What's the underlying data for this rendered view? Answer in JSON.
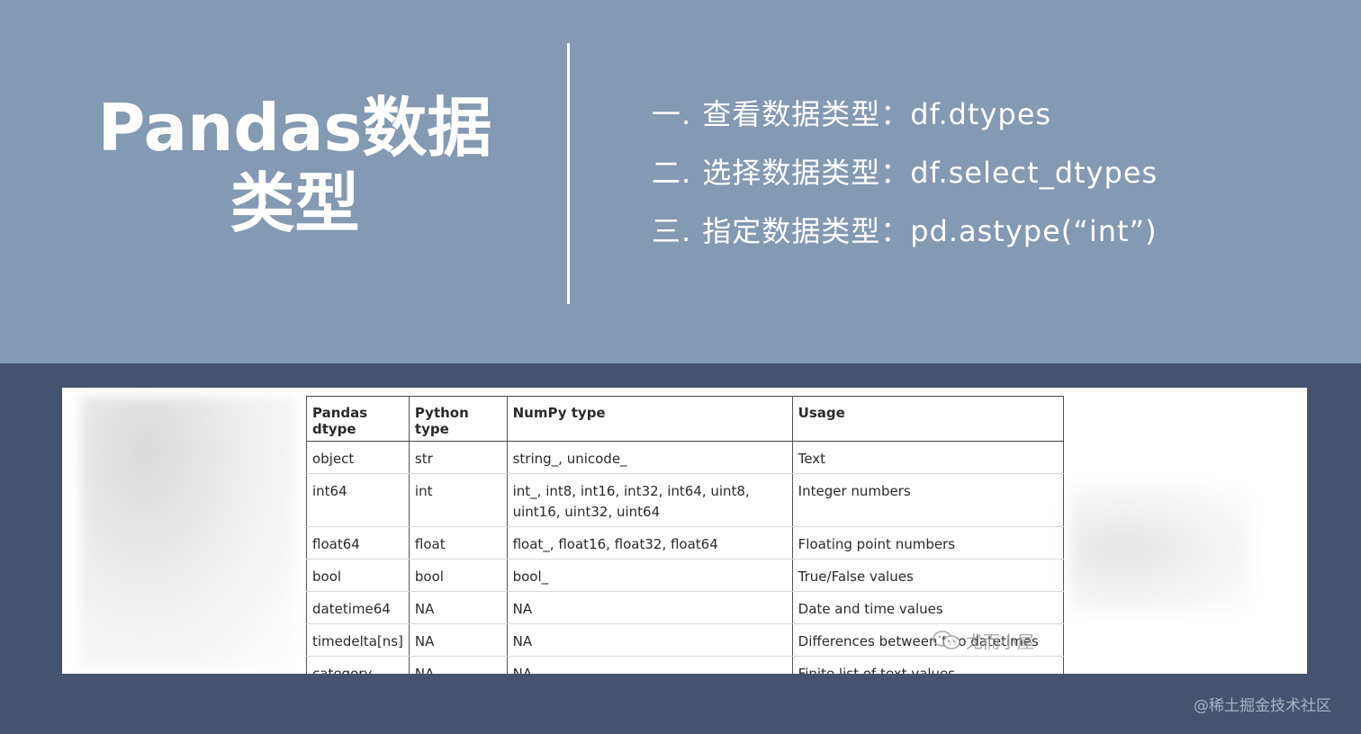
{
  "title": {
    "line1": "Pandas数据",
    "line2": "类型"
  },
  "points": [
    {
      "num": "一.",
      "text": "查看数据类型：df.dtypes"
    },
    {
      "num": "二.",
      "text": "选择数据类型：df.select_dtypes"
    },
    {
      "num": "三.",
      "text": "指定数据类型：pd.astype(“int”)"
    }
  ],
  "table": {
    "headers": [
      "Pandas dtype",
      "Python type",
      "NumPy type",
      "Usage"
    ],
    "rows": [
      [
        "object",
        "str",
        "string_, unicode_",
        "Text"
      ],
      [
        "int64",
        "int",
        "int_, int8, int16, int32, int64, uint8, uint16, uint32, uint64",
        "Integer numbers"
      ],
      [
        "float64",
        "float",
        "float_, float16, float32, float64",
        "Floating point numbers"
      ],
      [
        "bool",
        "bool",
        "bool_",
        "True/False values"
      ],
      [
        "datetime64",
        "NA",
        "NA",
        "Date and time values"
      ],
      [
        "timedelta[ns]",
        "NA",
        "NA",
        "Differences between two datetimes"
      ],
      [
        "category",
        "NA",
        "NA",
        "Finite list of text values"
      ]
    ]
  },
  "watermarks": {
    "table_overlay": "尤而小屋",
    "site": "@稀土掘金技术社区"
  },
  "colors": {
    "top_band": "#8499b2",
    "bottom_band": "#44546f",
    "text": "#ffffff"
  }
}
